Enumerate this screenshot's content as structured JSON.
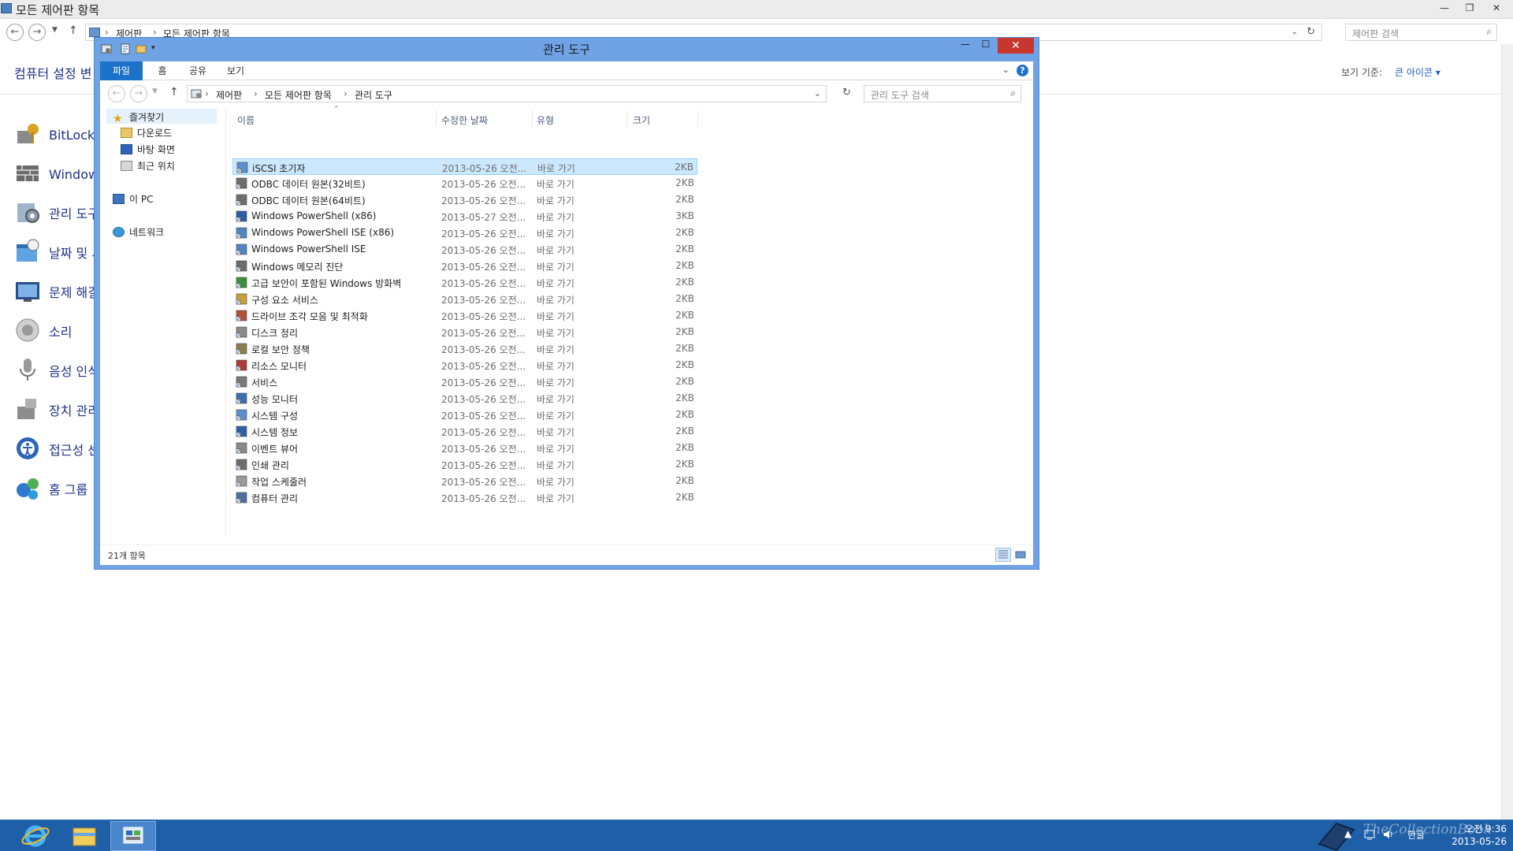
{
  "control_panel": {
    "title": "모든 제어판 항목",
    "address": [
      "제어판",
      "모든 제어판 항목"
    ],
    "search_placeholder": "제어판 검색",
    "heading": "컴퓨터 설정 변",
    "view_by_label": "보기 기준:",
    "view_by_value": "큰 아이콘 ▾",
    "items": [
      {
        "label": "BitLocker 드라이브 암호화",
        "icon": "bitlocker-icon"
      },
      {
        "label": "Windows 방화벽",
        "icon": "firewall-icon"
      },
      {
        "label": "관리 도구",
        "icon": "admin-tools-icon"
      },
      {
        "label": "날짜 및 시간",
        "icon": "date-time-icon"
      },
      {
        "label": "문제 해결",
        "icon": "troubleshoot-icon"
      },
      {
        "label": "소리",
        "icon": "sound-icon"
      },
      {
        "label": "음성 인식",
        "icon": "microphone-icon"
      },
      {
        "label": "장치 관리자",
        "icon": "device-manager-icon"
      },
      {
        "label": "접근성 센터",
        "icon": "accessibility-icon"
      },
      {
        "label": "홈 그룹",
        "icon": "homegroup-icon"
      }
    ]
  },
  "explorer": {
    "title": "관리 도구",
    "ribbon_tabs": [
      "파일",
      "홈",
      "공유",
      "보기"
    ],
    "address": [
      "제어판",
      "모든 제어판 항목",
      "관리 도구"
    ],
    "search_placeholder": "관리 도구 검색",
    "nav": {
      "favorites": "즐겨찾기",
      "downloads": "다운로드",
      "desktop": "바탕 화면",
      "recent": "최근 위치",
      "this_pc": "이 PC",
      "network": "네트워크"
    },
    "columns": {
      "name": "이름",
      "modified": "수정한 날짜",
      "type": "유형",
      "size": "크기"
    },
    "files": [
      {
        "name": "iSCSI 초기자",
        "date": "2013-05-26 오전...",
        "type": "바로 가기",
        "size": "2KB"
      },
      {
        "name": "ODBC 데이터 원본(32비트)",
        "date": "2013-05-26 오전...",
        "type": "바로 가기",
        "size": "2KB"
      },
      {
        "name": "ODBC 데이터 원본(64비트)",
        "date": "2013-05-26 오전...",
        "type": "바로 가기",
        "size": "2KB"
      },
      {
        "name": "Windows PowerShell (x86)",
        "date": "2013-05-27 오전...",
        "type": "바로 가기",
        "size": "3KB"
      },
      {
        "name": "Windows PowerShell ISE (x86)",
        "date": "2013-05-26 오전...",
        "type": "바로 가기",
        "size": "2KB"
      },
      {
        "name": "Windows PowerShell ISE",
        "date": "2013-05-26 오전...",
        "type": "바로 가기",
        "size": "2KB"
      },
      {
        "name": "Windows 메모리 진단",
        "date": "2013-05-26 오전...",
        "type": "바로 가기",
        "size": "2KB"
      },
      {
        "name": "고급 보안이 포함된 Windows 방화벽",
        "date": "2013-05-26 오전...",
        "type": "바로 가기",
        "size": "2KB"
      },
      {
        "name": "구성 요소 서비스",
        "date": "2013-05-26 오전...",
        "type": "바로 가기",
        "size": "2KB"
      },
      {
        "name": "드라이브 조각 모음 및 최적화",
        "date": "2013-05-26 오전...",
        "type": "바로 가기",
        "size": "2KB"
      },
      {
        "name": "디스크 정리",
        "date": "2013-05-26 오전...",
        "type": "바로 가기",
        "size": "2KB"
      },
      {
        "name": "로컬 보안 정책",
        "date": "2013-05-26 오전...",
        "type": "바로 가기",
        "size": "2KB"
      },
      {
        "name": "리소스 모니터",
        "date": "2013-05-26 오전...",
        "type": "바로 가기",
        "size": "2KB"
      },
      {
        "name": "서비스",
        "date": "2013-05-26 오전...",
        "type": "바로 가기",
        "size": "2KB"
      },
      {
        "name": "성능 모니터",
        "date": "2013-05-26 오전...",
        "type": "바로 가기",
        "size": "2KB"
      },
      {
        "name": "시스템 구성",
        "date": "2013-05-26 오전...",
        "type": "바로 가기",
        "size": "2KB"
      },
      {
        "name": "시스템 정보",
        "date": "2013-05-26 오전...",
        "type": "바로 가기",
        "size": "2KB"
      },
      {
        "name": "이벤트 뷰어",
        "date": "2013-05-26 오전...",
        "type": "바로 가기",
        "size": "2KB"
      },
      {
        "name": "인쇄 관리",
        "date": "2013-05-26 오전...",
        "type": "바로 가기",
        "size": "2KB"
      },
      {
        "name": "작업 스케줄러",
        "date": "2013-05-26 오전...",
        "type": "바로 가기",
        "size": "2KB"
      },
      {
        "name": "컴퓨터 관리",
        "date": "2013-05-26 오전...",
        "type": "바로 가기",
        "size": "2KB"
      }
    ],
    "status_count": "21개 항목"
  },
  "taskbar": {
    "ime": "한글",
    "time": "오전 9:36",
    "date": "2013-05-26",
    "watermark": "TheCollectionBook"
  },
  "colors": {
    "accent": "#1c72c8",
    "taskbar": "#1e5fa8",
    "window_border": "#6fa3e6",
    "close": "#c7372e"
  }
}
